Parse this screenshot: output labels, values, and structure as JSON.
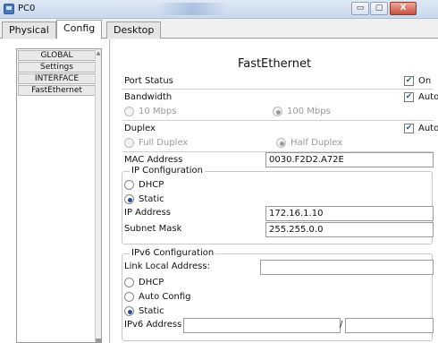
{
  "window": {
    "title": "PC0",
    "minimize": "▭",
    "maximize": "▢",
    "close": "X"
  },
  "tabs": [
    {
      "label": "Physical"
    },
    {
      "label": "Config"
    },
    {
      "label": "Desktop"
    }
  ],
  "sidebar": {
    "items": [
      {
        "label": "GLOBAL"
      },
      {
        "label": "Settings"
      },
      {
        "label": "INTERFACE"
      },
      {
        "label": "FastEthernet"
      }
    ]
  },
  "panel": {
    "title": "FastEthernet",
    "port_status": {
      "label": "Port Status",
      "checked": true,
      "option": "On"
    },
    "bandwidth": {
      "label": "Bandwidth",
      "auto_label": "Auto",
      "auto_checked": true,
      "options": [
        {
          "label": "10 Mbps",
          "selected": false
        },
        {
          "label": "100 Mbps",
          "selected": true
        }
      ]
    },
    "duplex": {
      "label": "Duplex",
      "auto_label": "Auto",
      "auto_checked": true,
      "options": [
        {
          "label": "Full Duplex",
          "selected": false
        },
        {
          "label": "Half Duplex",
          "selected": true
        }
      ]
    },
    "mac": {
      "label": "MAC Address",
      "value": "0030.F2D2.A72E"
    },
    "ip_config": {
      "legend": "IP Configuration",
      "dhcp": {
        "label": "DHCP",
        "selected": false
      },
      "static": {
        "label": "Static",
        "selected": true
      },
      "ip_address": {
        "label": "IP Address",
        "value": "172.16.1.10"
      },
      "subnet_mask": {
        "label": "Subnet Mask",
        "value": "255.255.0.0"
      }
    },
    "ipv6_config": {
      "legend": "IPv6 Configuration",
      "link_local": {
        "label": "Link Local Address:",
        "value": ""
      },
      "dhcp": {
        "label": "DHCP",
        "selected": false
      },
      "auto_config": {
        "label": "Auto Config",
        "selected": false
      },
      "static": {
        "label": "Static",
        "selected": true
      },
      "ipv6_address": {
        "label": "IPv6 Address",
        "value": "",
        "slash": "/",
        "prefix": ""
      }
    }
  },
  "colors": {
    "accent": "#1d4f9c",
    "check": "#2a5ba8"
  }
}
